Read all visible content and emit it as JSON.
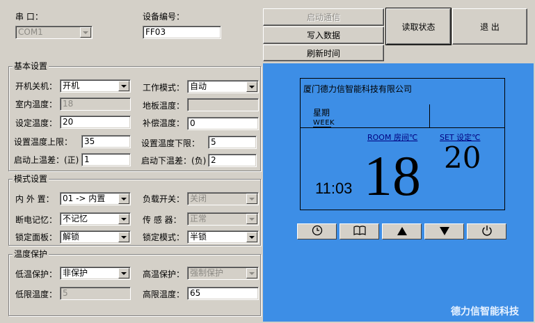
{
  "top": {
    "port_label": "串    口：",
    "port_value": "COM1",
    "device_id_label": "设备编号：",
    "device_id_value": "FF03"
  },
  "buttons": {
    "start_comm": "启动通信",
    "write_data": "写入数据",
    "refresh_time": "刷新时间",
    "read_status": "读取状态",
    "exit": "退  出"
  },
  "basic": {
    "title": "基本设置",
    "power_label": "开机关机：",
    "power_value": "开机",
    "work_mode_label": "工作模式：",
    "work_mode_value": "自动",
    "indoor_temp_label": "室内温度：",
    "indoor_temp_value": "18",
    "floor_temp_label": "地板温度：",
    "floor_temp_value": "",
    "set_temp_label": "设定温度：",
    "set_temp_value": "20",
    "comp_temp_label": "补偿温度：",
    "comp_temp_value": "0",
    "upper_limit_label": "设置温度上限：",
    "upper_limit_value": "35",
    "lower_limit_label": "设置温度下限：",
    "lower_limit_value": "5",
    "start_up_label": "启动上温差：(正)",
    "start_up_value": "1",
    "start_down_label": "启动下温差：(负)",
    "start_down_value": "2"
  },
  "mode": {
    "title": "模式设置",
    "inout_label": "内  外  置：",
    "inout_value": "01 -> 内置",
    "load_label": "负载开关：",
    "load_value": "关闭",
    "memory_label": "断电记忆：",
    "memory_value": "不记忆",
    "sensor_label": "传  感  器：",
    "sensor_value": "正常",
    "lock_panel_label": "锁定面板：",
    "lock_panel_value": "解锁",
    "lock_mode_label": "锁定模式：",
    "lock_mode_value": "半锁"
  },
  "protect": {
    "title": "温度保护",
    "low_label": "低温保护：",
    "low_value": "非保护",
    "high_label": "高温保护：",
    "high_value": "强制保护",
    "low_limit_label": "低限温度：",
    "low_limit_value": "5",
    "high_limit_label": "高限温度：",
    "high_limit_value": "65"
  },
  "display": {
    "company": "厦门德力信智能科技有限公司",
    "week_cn": "星期",
    "week_en": "WEEK",
    "room_label": "ROOM 房间℃",
    "set_label": "SET 设定℃",
    "set_value": "20",
    "time": "11:03",
    "room_value": "18",
    "watermark": "德力信智能科技"
  },
  "colors": {
    "panel_bg": "#3d8ee6",
    "lcd_link_text": "#000080"
  },
  "icons": [
    "clock-icon",
    "book-icon",
    "arrow-up-icon",
    "arrow-down-icon",
    "power-icon"
  ]
}
